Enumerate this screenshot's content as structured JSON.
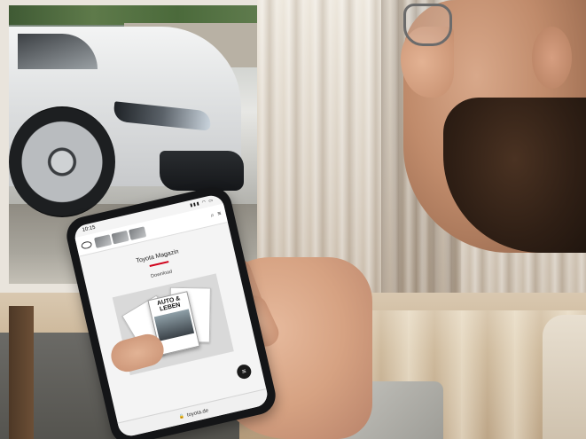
{
  "phone": {
    "status_time": "10:15",
    "status_icons": "▮▮▮ ◠ ▭",
    "header_icons": [
      "⌕",
      "≡"
    ],
    "magazine_title": "Toyota Magazin",
    "download_label": "Download",
    "cover_title_line1": "AUTO &",
    "cover_title_line2": "LEBEN",
    "url": "toyota.de",
    "lock_glyph": "🔒",
    "fab_glyph": "≡"
  },
  "colors": {
    "accent_red": "#d0021b"
  }
}
